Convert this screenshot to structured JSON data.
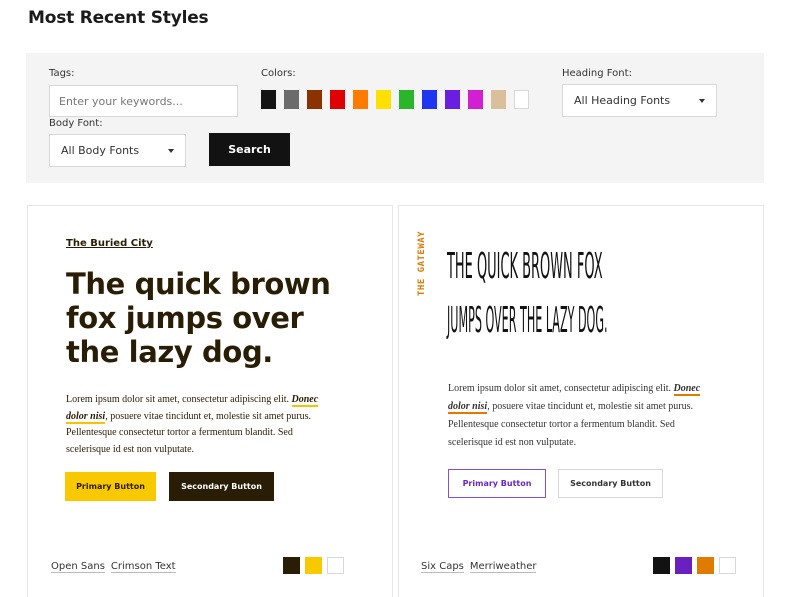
{
  "page": {
    "title": "Most Recent Styles"
  },
  "filters": {
    "tags_label": "Tags:",
    "tags_placeholder": "Enter your keywords...",
    "colors_label": "Colors:",
    "colors": [
      "#141414",
      "#6b6b6b",
      "#8a3300",
      "#e00000",
      "#ff7a00",
      "#ffe000",
      "#2bb52b",
      "#1f36f0",
      "#6a1fe0",
      "#d21fd2",
      "#d9bf9b",
      "#ffffff"
    ],
    "heading_font_label": "Heading Font:",
    "heading_font_value": "All Heading Fonts",
    "body_font_label": "Body Font:",
    "body_font_value": "All Body Fonts",
    "search_label": "Search"
  },
  "cards": [
    {
      "name": "The Buried City",
      "heading": "The quick brown fox jumps over the lazy dog.",
      "body_pre": "Lorem ipsum dolor sit amet, consectetur adipiscing elit. ",
      "body_highlight": "Donec dolor nisi",
      "body_post": ", posuere vitae tincidunt et, molestie sit amet purus. Pellentesque consectetur tortor a fermentum blandit. Sed scelerisque id est non vulputate.",
      "primary_label": "Primary Button",
      "secondary_label": "Secondary Button",
      "fonts": [
        "Open Sans",
        "Crimson Text"
      ],
      "palette": [
        "#2a1d05",
        "#f9c900",
        "#ffffff"
      ]
    },
    {
      "name": "THE GATEWAY",
      "heading_line1": "THE QUICK BROWN FOX",
      "heading_line2": "JUMPS OVER THE LAZY DOG.",
      "body_pre": "Lorem ipsum dolor sit amet, consectetur adipiscing elit. ",
      "body_highlight": "Donec dolor nisi",
      "body_post": ", posuere vitae tincidunt et, molestie sit amet purus. Pellentesque consectetur tortor a fermentum blandit. Sed scelerisque id est non vulputate.",
      "primary_label": "Primary Button",
      "secondary_label": "Secondary Button",
      "fonts": [
        "Six Caps",
        "Merriweather"
      ],
      "palette": [
        "#121212",
        "#6a1fc0",
        "#e07b00",
        "#ffffff"
      ]
    }
  ]
}
